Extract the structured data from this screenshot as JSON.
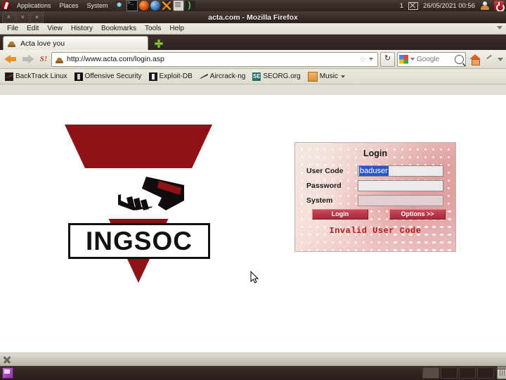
{
  "desktop": {
    "top_panel": {
      "menus": [
        "Applications",
        "Places",
        "System"
      ],
      "launchers": [
        {
          "name": "update-manager-icon"
        },
        {
          "name": "terminal-icon"
        },
        {
          "name": "firefox-icon"
        },
        {
          "name": "blue-spheres-icon"
        },
        {
          "name": "zenmap-icon"
        },
        {
          "name": "text-editor-icon"
        },
        {
          "name": "wifi-icon"
        }
      ],
      "workspace_indicator": "1",
      "mail_icon": "envelope-icon",
      "clock": "26/05/2021 00:56",
      "user_icon": "user-avatar-icon",
      "power_icon": "power-icon"
    },
    "bottom_panel": {
      "show_desktop_icon": "show-desktop-icon",
      "workspaces": 4,
      "active_workspace": 0,
      "trash_icon": "trash-icon"
    }
  },
  "browser": {
    "title": "acta.com - Mozilla Firefox",
    "window_buttons": {
      "minimize": "˄",
      "maximize": "˅",
      "close": "×"
    },
    "menus": [
      "File",
      "Edit",
      "View",
      "History",
      "Bookmarks",
      "Tools",
      "Help"
    ],
    "tab": {
      "label": "Acta love you",
      "favicon": "site-favicon"
    },
    "new_tab_label": "+",
    "url": "http://www.acta.com/login.asp",
    "search": {
      "engine": "Google",
      "placeholder": "Google"
    },
    "bookmarks": [
      {
        "label": "BackTrack Linux",
        "icon": "backtrack-icon"
      },
      {
        "label": "Offensive Security",
        "icon": "offsec-icon"
      },
      {
        "label": "Exploit-DB",
        "icon": "exploitdb-icon"
      },
      {
        "label": "Aircrack-ng",
        "icon": "aircrack-icon"
      },
      {
        "label": "SEORG.org",
        "icon": "seorg-icon"
      },
      {
        "label": "Music",
        "icon": "music-folder-icon"
      }
    ],
    "bookmark_seorg_badge": "SE"
  },
  "page": {
    "logo": {
      "text": "INGSOC",
      "alt": "ingsoc-handshake-logo"
    },
    "login": {
      "title": "Login",
      "fields": [
        {
          "label": "User Code",
          "value": "baduser",
          "selected": true,
          "disabled": false
        },
        {
          "label": "Password",
          "value": "",
          "selected": false,
          "disabled": false
        },
        {
          "label": "System",
          "value": "",
          "selected": false,
          "disabled": true
        }
      ],
      "login_button": "Login",
      "options_button": "Options >>",
      "error": "Invalid User Code"
    }
  },
  "colors": {
    "accent_red": "#8f1218",
    "button_red": "#b8384a",
    "error_red": "#b01c1c",
    "selection_blue": "#2a57c8",
    "panel_brown": "#322522"
  }
}
